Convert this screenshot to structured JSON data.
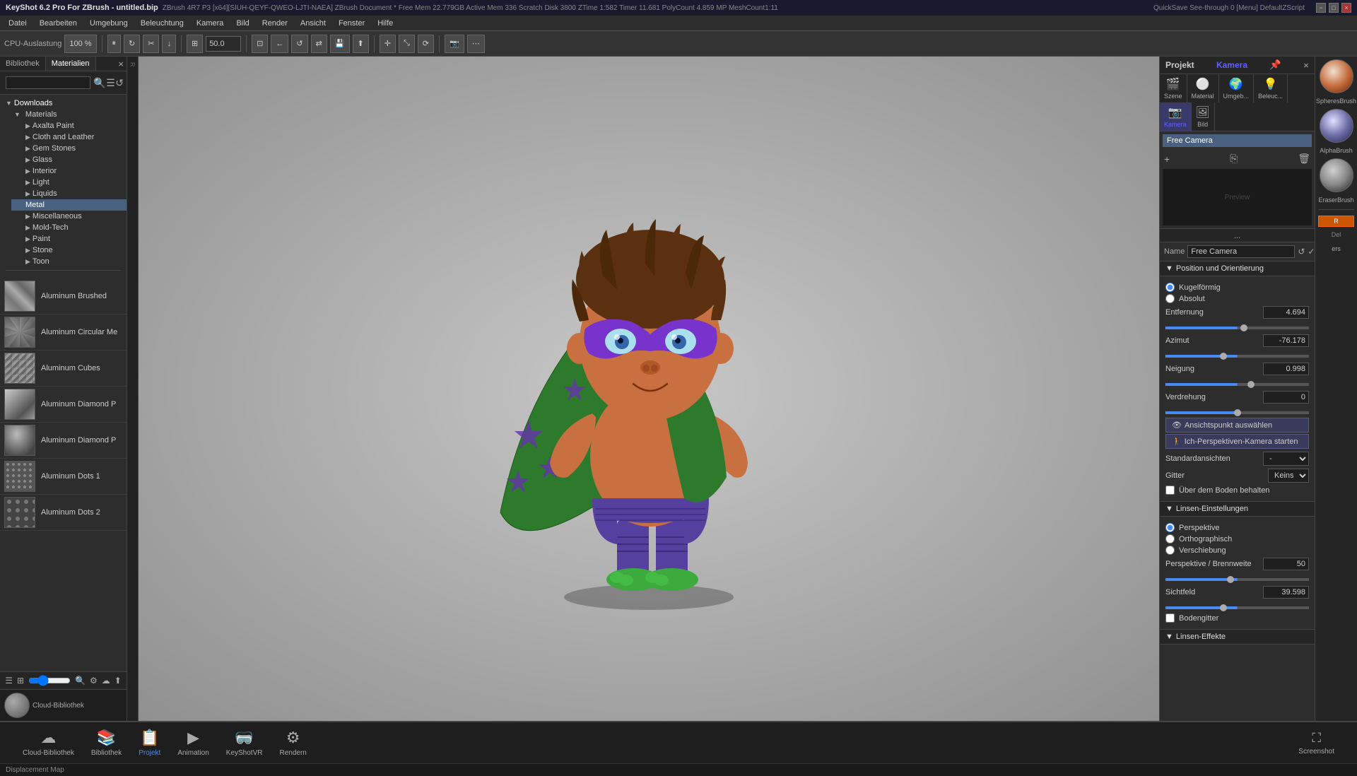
{
  "titlebar": {
    "title": "KeyShot 6.2 Pro For ZBrush - untitled.bip",
    "left_info": "ZBrush 4R7 P3 [x64][SIUH-QEYF-QWEO-LJTI-NAEA]   ZBrush Document   * Free Mem 22.779GB   Active Mem 336   Scratch Disk 3800   ZTime 1:582   Timer 11.681   PolyCount 4.859 MP   MeshCount1:11",
    "right_info": "QuickSave   See-through 0   [Menu] DefaultZScript",
    "window_buttons": [
      "−",
      "□",
      "×"
    ]
  },
  "menubar": {
    "items": [
      "Datei",
      "Bearbeiten",
      "Umgebung",
      "Beleuchtung",
      "Kamera",
      "Bild",
      "Render",
      "Ansicht",
      "Fenster",
      "Hilfe"
    ]
  },
  "toolbar": {
    "cpu_label": "CPU-Auslastung",
    "cpu_value": "100 %",
    "zoom_value": "50.0"
  },
  "left_panel": {
    "tabs": [
      "Bibliothek",
      "Materialien"
    ],
    "active_tab": "Materialien",
    "search_placeholder": "",
    "tree": {
      "root": "Downloads",
      "sections": [
        {
          "label": "Materials",
          "expanded": true,
          "children": [
            "Axalta Paint",
            "Cloth and Leather",
            "Gem Stones",
            "Glass",
            "Interior",
            "Light",
            "Liquids",
            "Metal",
            "Miscellaneous",
            "Mold-Tech",
            "Paint",
            "Stone",
            "Toon"
          ]
        }
      ],
      "selected_item": "Metal"
    },
    "materials": [
      {
        "name": "Aluminum Brushed",
        "thumb": "brushed"
      },
      {
        "name": "Aluminum Circular Me",
        "thumb": "circular"
      },
      {
        "name": "Aluminum Cubes",
        "thumb": "cubes"
      },
      {
        "name": "Aluminum Diamond P",
        "thumb": "diamond"
      },
      {
        "name": "Aluminum Diamond P",
        "thumb": "diamond2"
      },
      {
        "name": "Aluminum Dots 1",
        "thumb": "dots1"
      },
      {
        "name": "Aluminum Dots 2",
        "thumb": "dots2"
      }
    ]
  },
  "viewport": {
    "character_alt": "Cartoon superhero character"
  },
  "right_panel": {
    "header": {
      "project_label": "Projekt",
      "camera_label": "Kamera"
    },
    "tabs": [
      {
        "icon": "🎬",
        "label": "Szene"
      },
      {
        "icon": "⚪",
        "label": "Material"
      },
      {
        "icon": "🌍",
        "label": "Umgeb..."
      },
      {
        "icon": "💡",
        "label": "Beleuc..."
      },
      {
        "icon": "📷",
        "label": "Kamera"
      },
      {
        "icon": "🖼",
        "label": "Bild"
      }
    ],
    "active_tab": "Kamera",
    "camera_list": [
      "Free Camera"
    ],
    "selected_camera": "Free Camera",
    "camera_name": "Free Camera",
    "more_label": "...",
    "sections": {
      "position": {
        "header": "Position und Orientierung",
        "expanded": true,
        "radios": [
          {
            "id": "kugelformig",
            "label": "Kugelförmig",
            "checked": true
          },
          {
            "id": "absolut",
            "label": "Absolut",
            "checked": false
          }
        ],
        "params": [
          {
            "label": "Entfernung",
            "value": "4.694",
            "slider_pct": 55
          },
          {
            "label": "Azimut",
            "value": "-76.178",
            "slider_pct": 40
          },
          {
            "label": "Neigung",
            "value": "0.998",
            "slider_pct": 60
          },
          {
            "label": "Verdrehung",
            "value": "0",
            "slider_pct": 50
          }
        ],
        "buttons": [
          {
            "label": "Ansichtspunkt auswählen",
            "icon": "👁"
          },
          {
            "label": "Ich-Perspektiven-Kamera starten",
            "icon": "🚶"
          }
        ],
        "dropdowns": [
          {
            "label": "Standardansichten",
            "value": "-"
          },
          {
            "label": "Gitter",
            "value": "Keins"
          }
        ],
        "checkboxes": [
          {
            "label": "Über dem Boden behalten",
            "checked": false
          }
        ]
      },
      "linsen": {
        "header": "Linsen-Einstellungen",
        "expanded": true,
        "radios": [
          {
            "id": "perspektive",
            "label": "Perspektive",
            "checked": true
          },
          {
            "id": "orthographisch",
            "label": "Orthographisch",
            "checked": false
          },
          {
            "id": "verschiebung",
            "label": "Verschiebung",
            "checked": false
          }
        ],
        "params": [
          {
            "label": "Perspektive / Brennweite",
            "value": "50",
            "slider_pct": 45
          },
          {
            "label": "Sichtfeld",
            "value": "39.598",
            "slider_pct": 40
          }
        ],
        "checkboxes": [
          {
            "label": "Bodengitter",
            "checked": false
          }
        ]
      },
      "linsen_effekte": {
        "header": "Linsen-Effekte",
        "expanded": true
      }
    }
  },
  "bottom_bar": {
    "buttons": [
      {
        "icon": "☁",
        "label": "Cloud-Bibliothek"
      },
      {
        "icon": "📚",
        "label": "Bibliothek"
      },
      {
        "icon": "📋",
        "label": "Projekt",
        "active": true
      },
      {
        "icon": "▶",
        "label": "Animation"
      },
      {
        "icon": "🥽",
        "label": "KeyShotVR"
      },
      {
        "icon": "⚙",
        "label": "Rendern"
      }
    ],
    "screenshot_label": "Screenshot"
  },
  "status_bar": {
    "info": "Displacement Map"
  },
  "sphere_panel": {
    "items": [
      {
        "label": "SpheresBrush"
      },
      {
        "label": "AlphaBrush"
      },
      {
        "label": "EraserBrush"
      }
    ]
  }
}
